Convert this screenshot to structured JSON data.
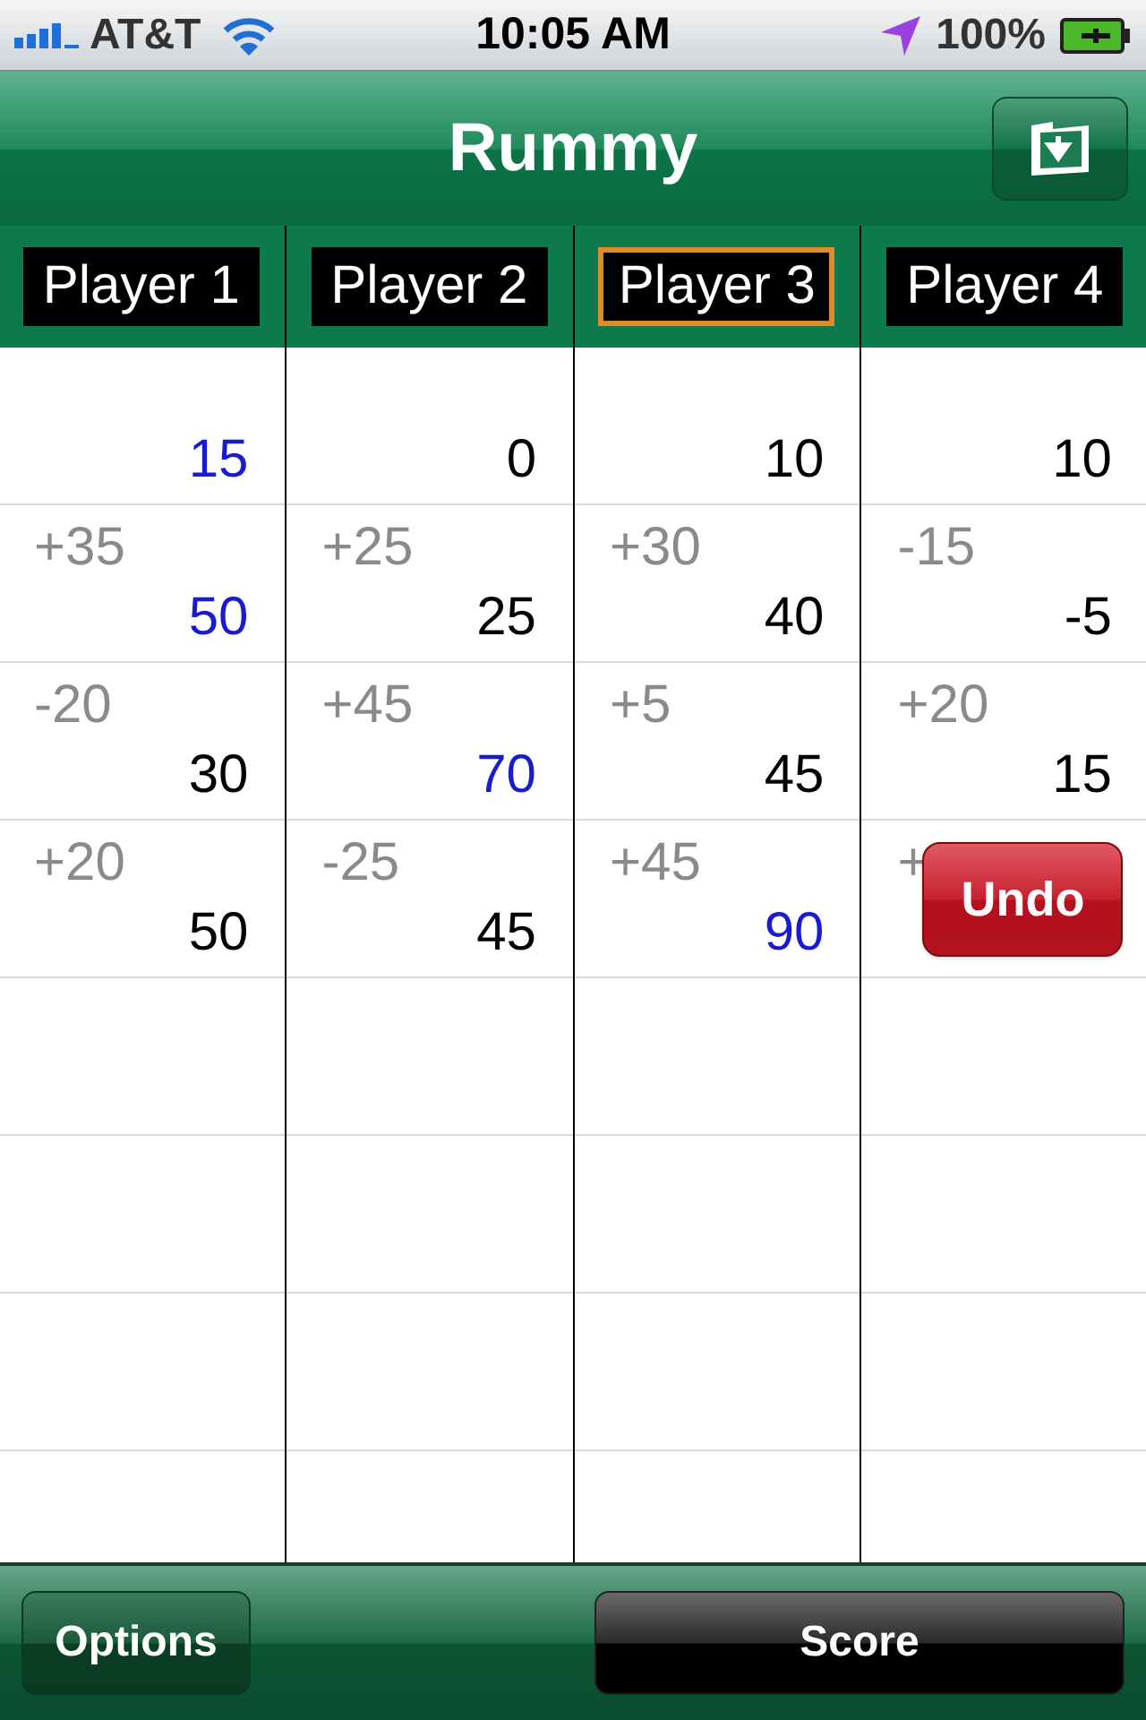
{
  "status_bar": {
    "carrier": "AT&T",
    "time": "10:05 AM",
    "battery": "100%"
  },
  "nav": {
    "title": "Rummy"
  },
  "players": [
    {
      "name": "Player 1",
      "selected": false,
      "scores": [
        {
          "total": "15",
          "leader": true
        },
        {
          "delta": "+35",
          "total": "50",
          "leader": true
        },
        {
          "delta": "-20",
          "total": "30",
          "leader": false
        },
        {
          "delta": "+20",
          "total": "50",
          "leader": false
        }
      ]
    },
    {
      "name": "Player 2",
      "selected": false,
      "scores": [
        {
          "total": "0",
          "leader": false
        },
        {
          "delta": "+25",
          "total": "25",
          "leader": false
        },
        {
          "delta": "+45",
          "total": "70",
          "leader": true
        },
        {
          "delta": "-25",
          "total": "45",
          "leader": false
        }
      ]
    },
    {
      "name": "Player 3",
      "selected": true,
      "scores": [
        {
          "total": "10",
          "leader": false
        },
        {
          "delta": "+30",
          "total": "40",
          "leader": false
        },
        {
          "delta": "+5",
          "total": "45",
          "leader": false
        },
        {
          "delta": "+45",
          "total": "90",
          "leader": true
        }
      ]
    },
    {
      "name": "Player 4",
      "selected": false,
      "scores": [
        {
          "total": "10",
          "leader": false
        },
        {
          "delta": "-15",
          "total": "-5",
          "leader": false
        },
        {
          "delta": "+20",
          "total": "15",
          "leader": false
        },
        {
          "delta": "+",
          "undo": "Undo"
        }
      ]
    }
  ],
  "toolbar": {
    "left": "Options",
    "right": "Score"
  }
}
